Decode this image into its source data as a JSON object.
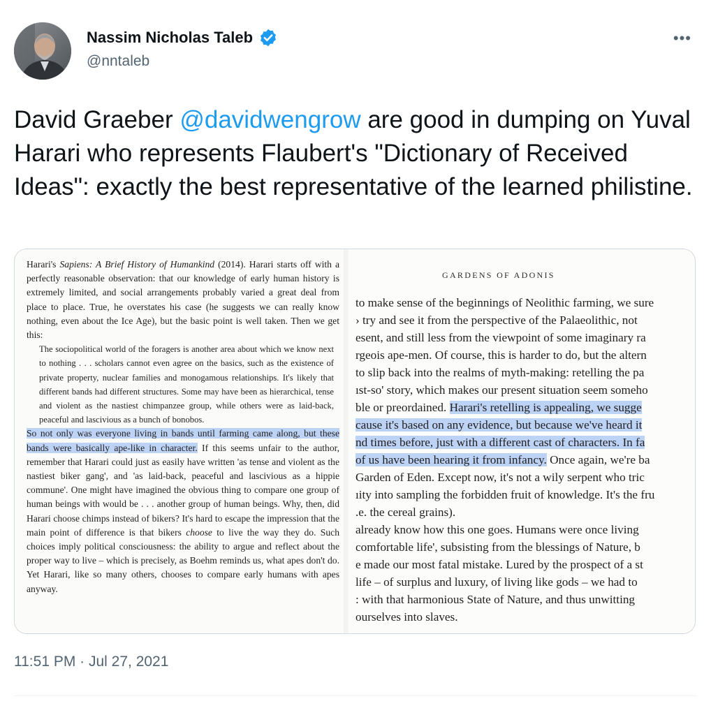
{
  "author": {
    "name": "Nassim Nicholas Taleb",
    "handle": "@nntaleb",
    "verified": true,
    "avatar_icon": "profile-photo-icon"
  },
  "menu_icon": "more-horizontal-icon",
  "more_label": "•••",
  "tweet": {
    "text_before": "David Graeber ",
    "mention": "@davidwengrow",
    "text_after": " are good in dumping on Yuval Harari who represents Flaubert's \"Dictionary of Received Ideas\": exactly the best representative of the learned philistine."
  },
  "media": {
    "left_page": {
      "intro_prefix": "Harari's ",
      "intro_title": "Sapiens: A Brief History of Humankind",
      "intro_rest": " (2014). Harari starts off with a perfectly reasonable observation: that our knowledge of early human history is extremely limited, and social arrangements probably varied a great deal from place to place. True, he overstates his case (he suggests we can really know nothing, even about the Ice Age), but the basic point is well taken. Then we get this:",
      "quote": "The sociopolitical world of the foragers is another area about which we know next to nothing . . . scholars cannot even agree on the basics, such as the existence of private property, nuclear families and monogamous relationships. It's likely that different bands had different structures. Some may have been as hierarchical, tense and violent as the nastiest chimpanzee group, while others were as laid-back, peaceful and lascivious as a bunch of bonobos.",
      "highlight": "So not only was everyone living in bands until farming came along, but these bands were basically ape-like in character.",
      "after_a": " If this seems unfair to the author, remember that Harari could just as easily have written 'as tense and violent as the nastiest biker gang', and 'as laid-back, peaceful and lascivious as a hippie commune'. One might have imagined the obvious thing to compare one group of human beings with would be . . . another group of human beings. Why, then, did Harari choose chimps instead of bikers? It's hard to escape the impression that the main point of difference is that bikers ",
      "after_em": "choose",
      "after_b": " to live the way they do. Such choices imply political consciousness: the ability to argue and reflect about the proper way to live – which is precisely, as Boehm reminds us, what apes don't do. Yet Harari, like so many others, chooses to compare early humans with apes anyway."
    },
    "right_page": {
      "running_head": "GARDENS OF ADONIS",
      "lines": [
        {
          "pre": "to make sense of the beginnings of Neolithic farming, we sure",
          "hl": "",
          "post": ""
        },
        {
          "pre": "› try and see it from the perspective of the Palaeolithic, not",
          "hl": "",
          "post": ""
        },
        {
          "pre": "esent, and still less from the viewpoint of some imaginary ra",
          "hl": "",
          "post": ""
        },
        {
          "pre": "rgeois ape-men. Of course, this is harder to do, but the altern",
          "hl": "",
          "post": ""
        },
        {
          "pre": "to slip back into the realms of myth-making: retelling the pa",
          "hl": "",
          "post": ""
        },
        {
          "pre": "ıst-so' story, which makes our present situation seem someho",
          "hl": "",
          "post": ""
        },
        {
          "pre": "ble or preordained. ",
          "hl": "Harari's retelling is appealing, we sugge",
          "post": ""
        },
        {
          "pre": "",
          "hl": "cause it's based on any evidence, but because we've heard it",
          "post": ""
        },
        {
          "pre": "",
          "hl": "nd times before, just with a different cast of characters. In fa",
          "post": ""
        },
        {
          "pre": "",
          "hl": "of us have been hearing it from infancy.",
          "post": " Once again, we're ba"
        },
        {
          "pre": "Garden of Eden. Except now, it's not a wily serpent who tric",
          "hl": "",
          "post": ""
        },
        {
          "pre": "ıity into sampling the forbidden fruit of knowledge. It's the fru",
          "hl": "",
          "post": ""
        },
        {
          "pre": ".e. the cereal grains).",
          "hl": "",
          "post": ""
        },
        {
          "pre": "already know how this one goes. Humans were once living",
          "hl": "",
          "post": ""
        },
        {
          "pre": "comfortable life', subsisting from the blessings of Nature, b",
          "hl": "",
          "post": ""
        },
        {
          "pre": "e made our most fatal mistake. Lured by the prospect of a st",
          "hl": "",
          "post": ""
        },
        {
          "pre": "life – of surplus and luxury, of living like gods – we had to",
          "hl": "",
          "post": ""
        },
        {
          "pre": ": with that harmonious State of Nature, and thus unwitting",
          "hl": "",
          "post": ""
        },
        {
          "pre": "ourselves into slaves.",
          "hl": "",
          "post": ""
        }
      ]
    }
  },
  "timestamp": "11:51 PM · Jul 27, 2021",
  "colors": {
    "text": "#0f1419",
    "secondary": "#536471",
    "link": "#1d9bf0",
    "verified": "#1d9bf0",
    "highlight": "#bcd3f5",
    "border": "#cfd9de"
  }
}
